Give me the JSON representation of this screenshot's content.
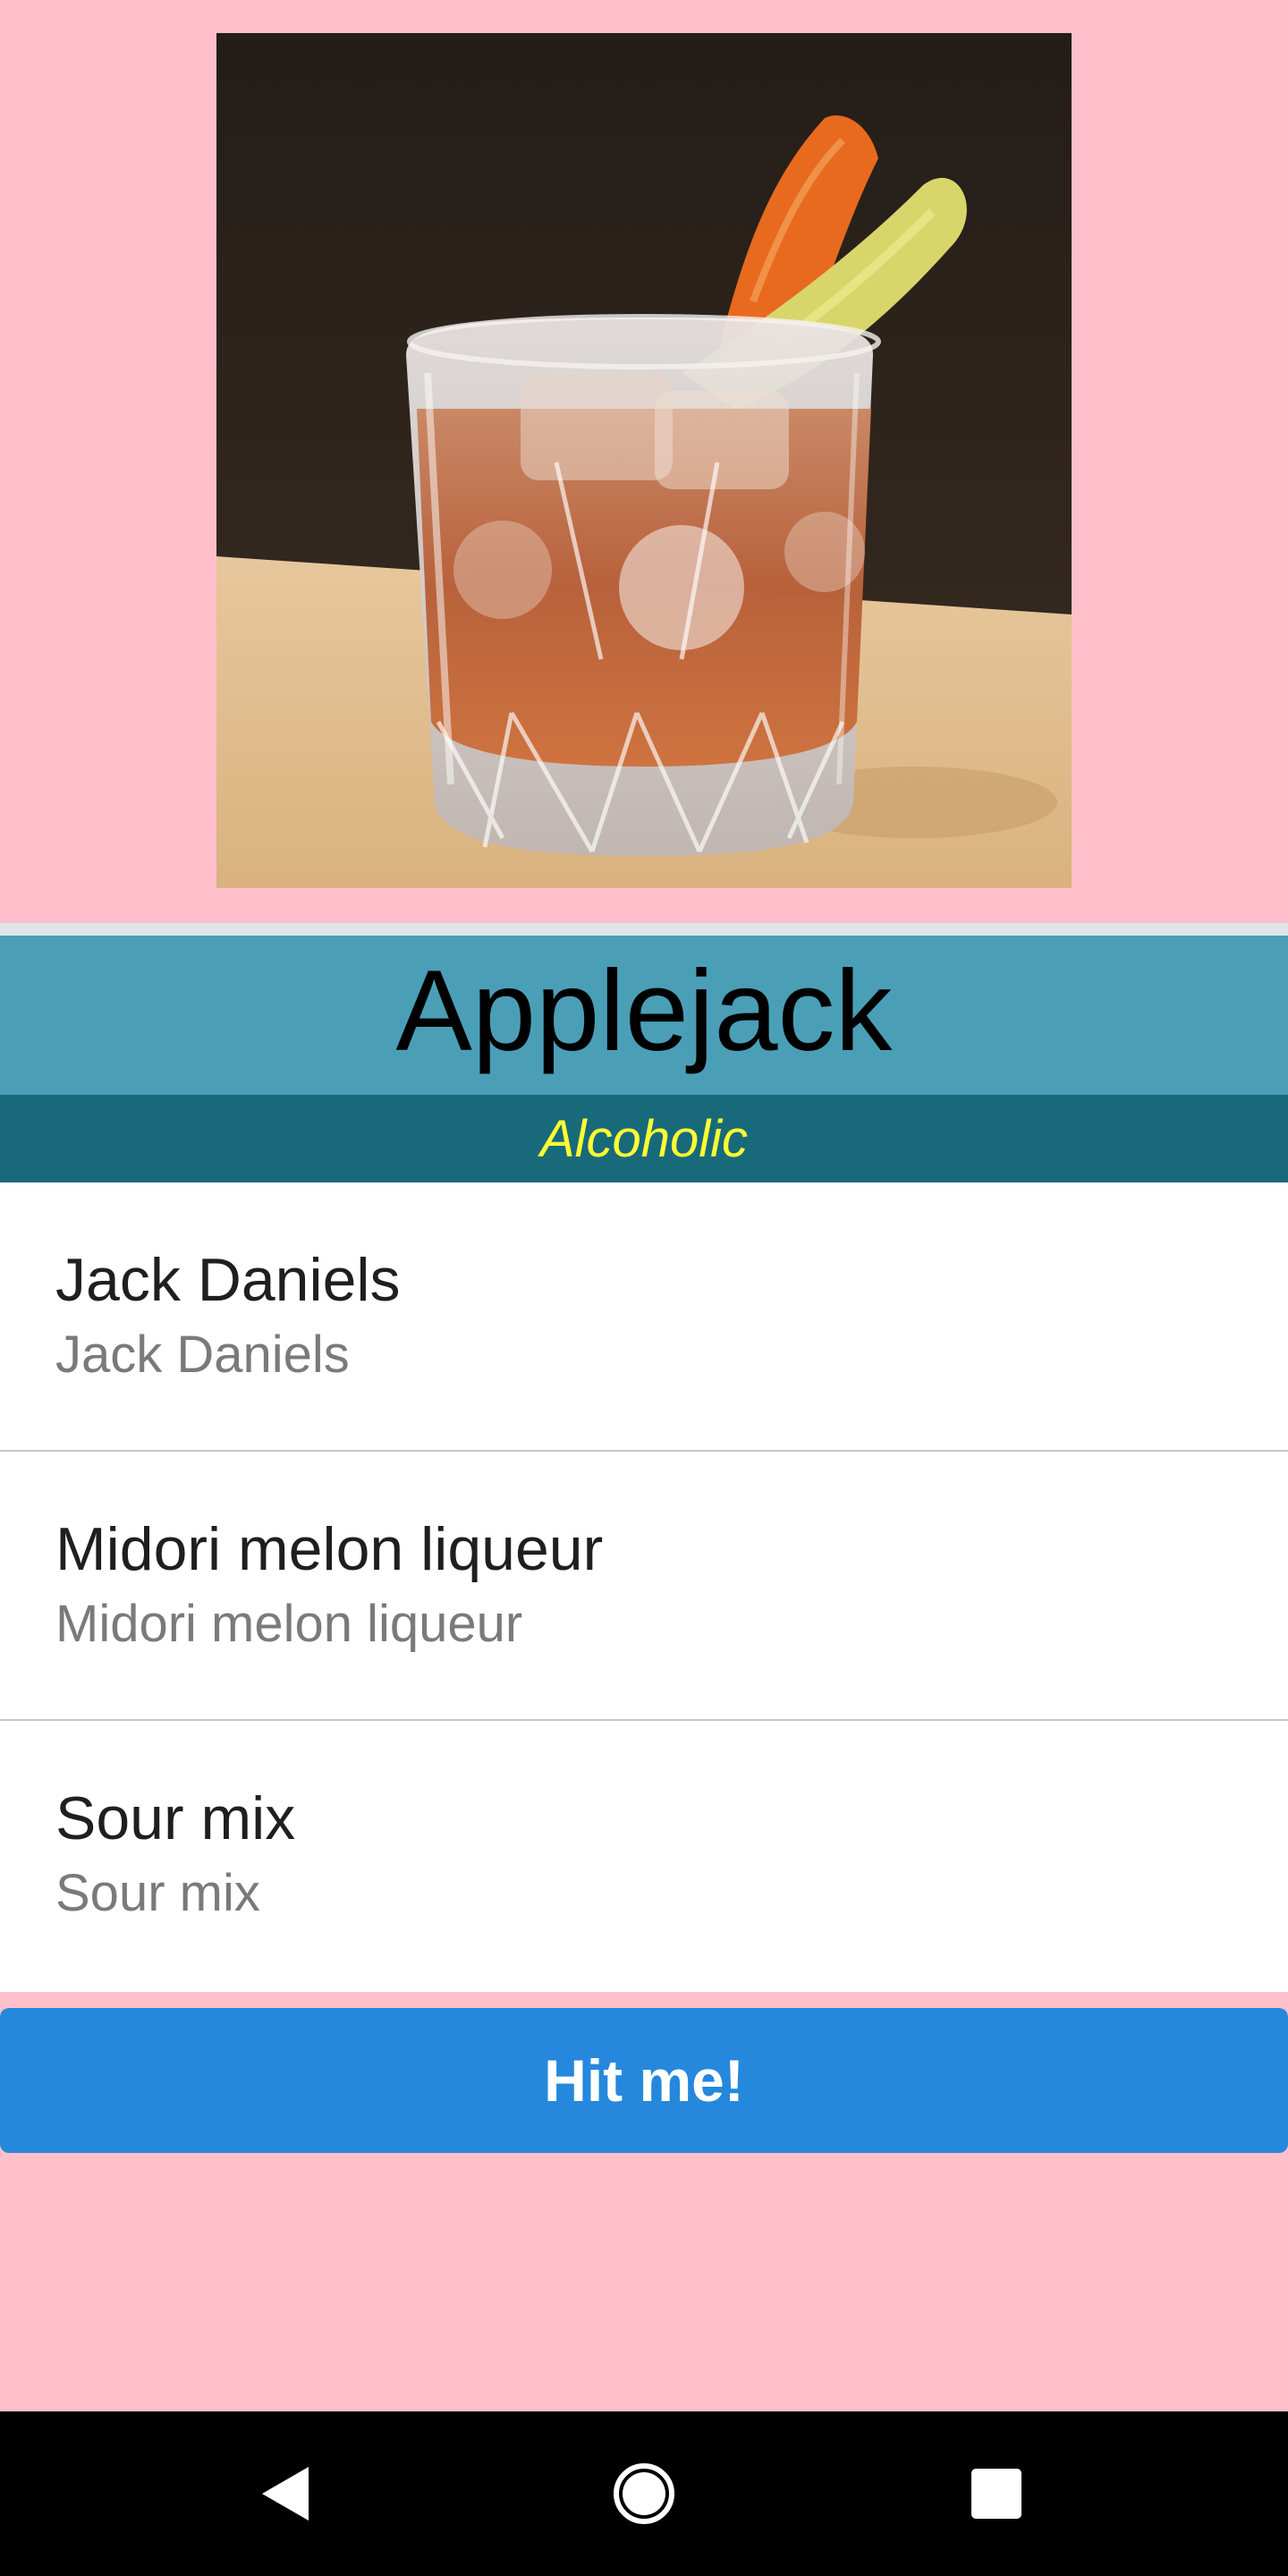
{
  "drink": {
    "name": "Applejack",
    "category": "Alcoholic",
    "image": "cocktail in cut-crystal rocks glass with orange and lemon peel garnish"
  },
  "ingredients": [
    {
      "name": "Jack Daniels",
      "measure": "Jack Daniels"
    },
    {
      "name": "Midori melon liqueur",
      "measure": "Midori melon liqueur"
    },
    {
      "name": "Sour mix",
      "measure": "Sour mix"
    }
  ],
  "action": {
    "label": "Hit me!"
  },
  "nav": {
    "back_icon": "back-triangle-icon",
    "home_icon": "home-circle-icon",
    "recents_icon": "recents-square-icon"
  },
  "colors": {
    "background": "#ffc0cb",
    "title_bar": "#4a9fb7",
    "category_bar": "#186a7b",
    "category_text": "#ffff33",
    "button": "#2588dc"
  }
}
